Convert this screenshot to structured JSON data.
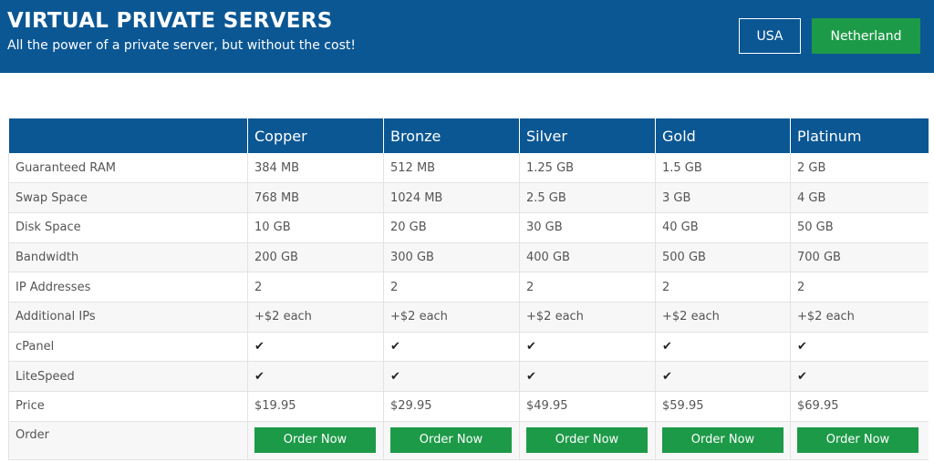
{
  "header": {
    "title": "VIRTUAL PRIVATE SERVERS",
    "subtitle": "All the power of a private server, but without the cost!",
    "regions": [
      {
        "label": "USA",
        "active": false
      },
      {
        "label": "Netherland",
        "active": true
      }
    ]
  },
  "table": {
    "plans": [
      "Copper",
      "Bronze",
      "Silver",
      "Gold",
      "Platinum"
    ],
    "rows": [
      {
        "label": "Guaranteed RAM",
        "values": [
          "384 MB",
          "512 MB",
          "1.25 GB",
          "1.5 GB",
          "2 GB"
        ]
      },
      {
        "label": "Swap Space",
        "values": [
          "768 MB",
          "1024 MB",
          "2.5 GB",
          "3 GB",
          "4 GB"
        ]
      },
      {
        "label": "Disk Space",
        "values": [
          "10 GB",
          "20 GB",
          "30 GB",
          "40 GB",
          "50 GB"
        ]
      },
      {
        "label": "Bandwidth",
        "values": [
          "200 GB",
          "300 GB",
          "400 GB",
          "500 GB",
          "700 GB"
        ]
      },
      {
        "label": "IP Addresses",
        "values": [
          "2",
          "2",
          "2",
          "2",
          "2"
        ]
      },
      {
        "label": "Additional IPs",
        "values": [
          "+$2 each",
          "+$2 each",
          "+$2 each",
          "+$2 each",
          "+$2 each"
        ]
      },
      {
        "label": "cPanel",
        "values": [
          "✔",
          "✔",
          "✔",
          "✔",
          "✔"
        ]
      },
      {
        "label": "LiteSpeed",
        "values": [
          "✔",
          "✔",
          "✔",
          "✔",
          "✔"
        ]
      },
      {
        "label": "Price",
        "values": [
          "$19.95",
          "$29.95",
          "$49.95",
          "$59.95",
          "$69.95"
        ]
      }
    ],
    "order_label": "Order",
    "order_button_label": "Order Now"
  },
  "colors": {
    "header_bg": "#0b5794",
    "accent_green": "#1d9a48"
  },
  "icons": {
    "check": "check-icon"
  }
}
